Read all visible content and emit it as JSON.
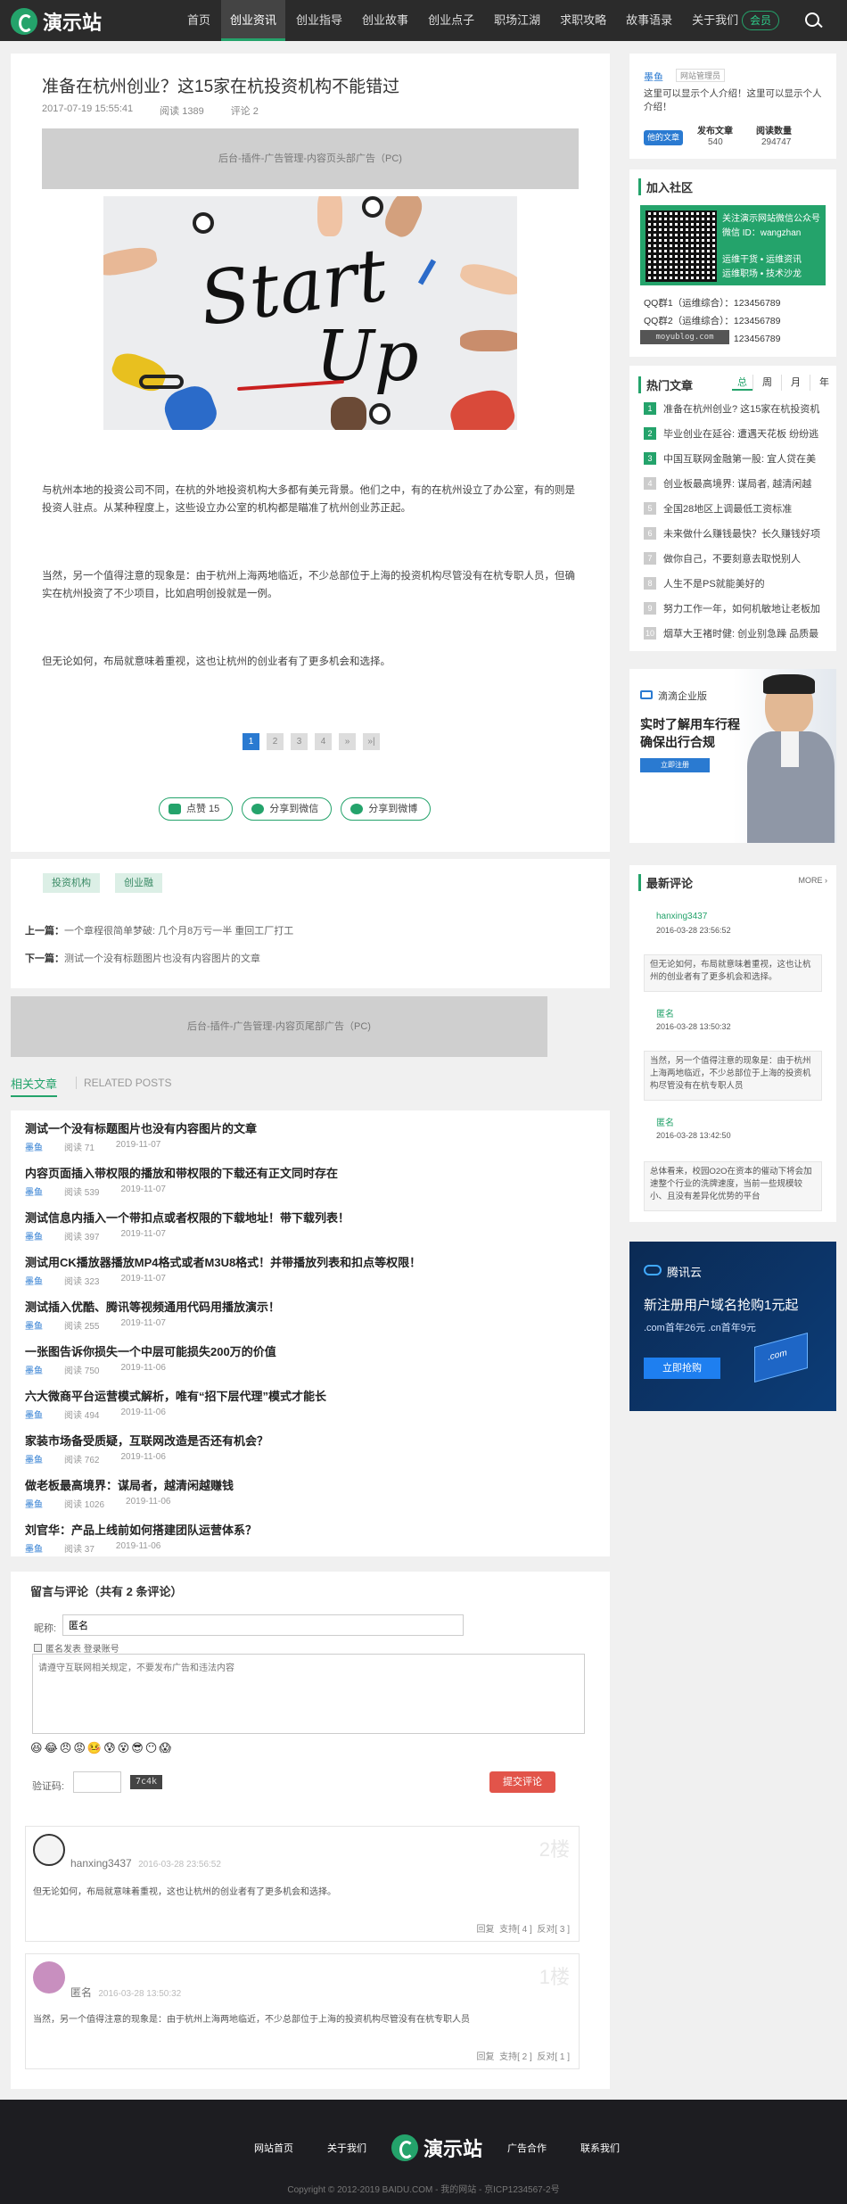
{
  "header": {
    "logo": "演示站",
    "nav": [
      "首页",
      "创业资讯",
      "创业指导",
      "创业故事",
      "创业点子",
      "职场江湖",
      "求职攻略",
      "故事语录",
      "关于我们"
    ],
    "vip": "会员"
  },
  "article": {
    "title": "准备在杭州创业？这15家在杭投资机构不能错过",
    "date": "2017-07-19 15:55:41",
    "reads": "阅读 1389",
    "comments": "评论 2",
    "ad_top": "后台-插件-广告管理-内容页头部广告（PC)",
    "photo_text_1": "Start",
    "photo_text_2": "Up",
    "paragraphs": [
      "与杭州本地的投资公司不同，在杭的外地投资机构大多都有美元背景。他们之中，有的在杭州设立了办公室，有的则是投资人驻点。从某种程度上，这些设立办公室的机构都是瞄准了杭州创业苏正起。",
      "当然，另一个值得注意的现象是：由于杭州上海两地临近，不少总部位于上海的投资机构尽管没有在杭专职人员，但确实在杭州投资了不少项目，比如启明创投就是一例。",
      "但无论如何，布局就意味着重视，这也让杭州的创业者有了更多机会和选择。"
    ],
    "pages": [
      "1",
      "2",
      "3",
      "4",
      "»",
      "»|"
    ],
    "share": {
      "like": "点赞 15",
      "wechat": "分享到微信",
      "weibo": "分享到微博"
    }
  },
  "tags": [
    "投资机构",
    "创业融"
  ],
  "prev": {
    "label": "上一篇：",
    "title": "一个章程很简单梦破: 几个月8万亏一半 重回工厂打工"
  },
  "next": {
    "label": "下一篇：",
    "title": "测试一个没有标题图片也没有内容图片的文章"
  },
  "ad_bottom": "后台-插件-广告管理-内容页尾部广告（PC)",
  "related": {
    "tab_active": "相关文章",
    "tab_other": "RELATED POSTS",
    "items": [
      {
        "title": "测试一个没有标题图片也没有内容图片的文章",
        "author": "墨鱼",
        "reads": "阅读 71",
        "date": "2019-11-07"
      },
      {
        "title": "内容页面插入带权限的播放和带权限的下载还有正文同时存在",
        "author": "墨鱼",
        "reads": "阅读 539",
        "date": "2019-11-07"
      },
      {
        "title": "测试信息内插入一个带扣点或者权限的下载地址！带下载列表！",
        "author": "墨鱼",
        "reads": "阅读 397",
        "date": "2019-11-07"
      },
      {
        "title": "测试用CK播放器播放MP4格式或者M3U8格式！并带播放列表和扣点等权限！",
        "author": "墨鱼",
        "reads": "阅读 323",
        "date": "2019-11-07"
      },
      {
        "title": "测试插入优酷、腾讯等视频通用代码用播放演示！",
        "author": "墨鱼",
        "reads": "阅读 255",
        "date": "2019-11-07"
      },
      {
        "title": "一张图告诉你损失一个中层可能损失200万的价值",
        "author": "墨鱼",
        "reads": "阅读 750",
        "date": "2019-11-06"
      },
      {
        "title": "六大微商平台运营模式解析，唯有“招下层代理”模式才能长",
        "author": "墨鱼",
        "reads": "阅读 494",
        "date": "2019-11-06"
      },
      {
        "title": "家装市场备受质疑，互联网改造是否还有机会？",
        "author": "墨鱼",
        "reads": "阅读 762",
        "date": "2019-11-06"
      },
      {
        "title": "做老板最高境界：谋局者，越清闲越赚钱",
        "author": "墨鱼",
        "reads": "阅读 1026",
        "date": "2019-11-06"
      },
      {
        "title": "刘官华：产品上线前如何搭建团队运营体系？",
        "author": "墨鱼",
        "reads": "阅读 37",
        "date": "2019-11-06"
      }
    ]
  },
  "comment_form": {
    "heading": "留言与评论（共有 2 条评论）",
    "nick_label": "昵称:",
    "nick_value": "匿名",
    "anon_label": "匿名发表 登录账号",
    "textarea_placeholder": "请遵守互联网相关规定，不要发布广告和违法内容",
    "captcha_label": "验证码:",
    "captcha_code": "7c4k",
    "submit": "提交评论",
    "emojis": [
      "😆",
      "😂",
      "😠",
      "😡",
      "🤒",
      "😰",
      "😵",
      "😎",
      "😶",
      "😱"
    ]
  },
  "comment_list": [
    {
      "user": "hanxing3437",
      "time": "2016-03-28 23:56:52",
      "floor": "2楼",
      "text": "但无论如何，布局就意味着重视，这也让杭州的创业者有了更多机会和选择。",
      "actions": "回复  支持[ 4 ]  反对[ 3 ]"
    },
    {
      "user": "匿名",
      "time": "2016-03-28 13:50:32",
      "floor": "1楼",
      "text": "当然，另一个值得注意的现象是：由于杭州上海两地临近，不少总部位于上海的投资机构尽管没有在杭专职人员",
      "actions": "回复  支持[ 2 ]  反对[ 1 ]"
    }
  ],
  "sidebar": {
    "author": {
      "name": "墨鱼",
      "badge": "网站管理员",
      "bio": "这里可以显示个人介绍！这里可以显示个人介绍！",
      "button": "他的文章",
      "posts_label": "发布文章",
      "posts": "540",
      "reads_label": "阅读数量",
      "reads": "294747"
    },
    "community": {
      "title": "加入社区",
      "qr_heading": "关注演示网站微信公众号",
      "qr_sub": "微信 ID：wangzhan",
      "qr_items": [
        "运维干货 • 运维资讯",
        "运维职场 • 技术沙龙"
      ],
      "qq": [
        "QQ群1（运维综合）：123456789",
        "QQ群2（运维综合）：123456789",
        "QQ群3（运维综合）：123456789"
      ],
      "watermark": "moyublog.com"
    },
    "hot": {
      "title": "热门文章",
      "tabs": [
        "总",
        "周",
        "月",
        "年"
      ],
      "items": [
        "准备在杭州创业? 这15家在杭投资机",
        "毕业创业在延谷: 遭遇天花板 纷纷逃",
        "中国互联网金融第一股: 宜人贷在美",
        "创业板最高境界: 谋局者, 越清闲越",
        "全国28地区上调最低工资标准",
        "未来做什么赚钱最快？长久赚钱好项",
        "做你自己，不要刻意去取悦别人",
        "人生不是PS就能美好的",
        "努力工作一年，如何机敏地让老板加",
        "烟草大王褚时健: 创业别急躁 品质最"
      ]
    },
    "ad1": {
      "brand": "滴滴企业版",
      "headline": "实时了解用车行程",
      "headline2": "确保出行合规",
      "button": "立即注册"
    },
    "latest": {
      "title": "最新评论",
      "more": "MORE",
      "items": [
        {
          "user": "hanxing3437",
          "time": "2016-03-28 23:56:52",
          "text": "但无论如何，布局就意味着重视，这也让杭州的创业者有了更多机会和选择。"
        },
        {
          "user": "匿名",
          "time": "2016-03-28 13:50:32",
          "text": "当然，另一个值得注意的现象是：由于杭州上海两地临近，不少总部位于上海的投资机构尽管没有在杭专职人员"
        },
        {
          "user": "匿名",
          "time": "2016-03-28 13:42:50",
          "text": "总体看来，校园O2O在资本的催动下将会加速整个行业的洗牌速度，当前一些规模较小、且没有差异化优势的平台"
        }
      ]
    },
    "ad2": {
      "brand": "腾讯云",
      "headline": "新注册用户域名抢购1元起",
      "sub": ".com首年26元 .cn首年9元",
      "button": "立即抢购",
      "badge": ".com"
    }
  },
  "footer": {
    "links": [
      "网站首页",
      "关于我们",
      "广告合作",
      "联系我们"
    ],
    "logo": "演示站",
    "copyright": "Copyright © 2012-2019 BAIDU.COM - 我的网站 - 京ICP1234567-2号"
  },
  "colors": {
    "accent": "#24a36b",
    "link": "#2a7ad1",
    "submit": "#e2544a"
  }
}
